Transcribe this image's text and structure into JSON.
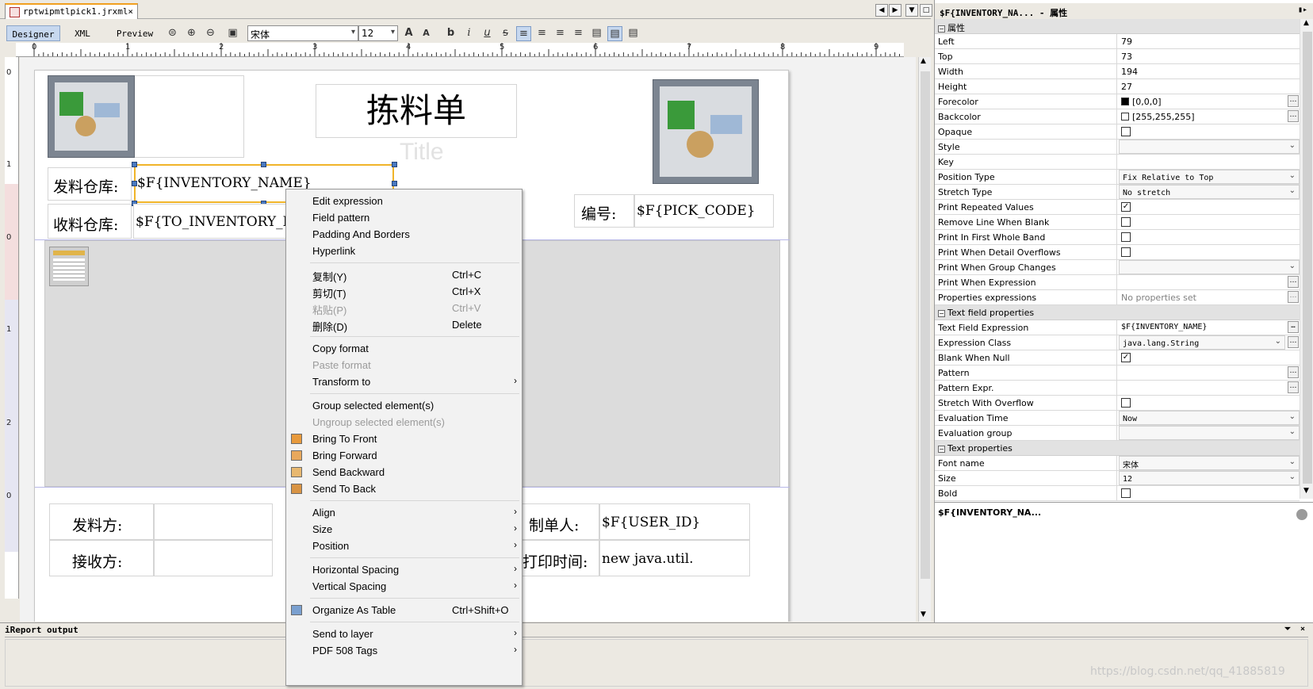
{
  "editor": {
    "file_tab": "rptwipmtlpick1.jrxml",
    "close_glyph": "×",
    "mode_tabs": [
      "Designer",
      "XML",
      "Preview"
    ],
    "font_name": "宋体",
    "font_size": "12",
    "ruler_h": [
      "0",
      "1",
      "2",
      "3",
      "4",
      "5",
      "6",
      "7",
      "8",
      "9"
    ],
    "ruler_v": [
      "0",
      "1",
      "0",
      "1",
      "2",
      "0"
    ]
  },
  "report": {
    "title": "拣料单",
    "title_placeholder": "Title",
    "issue_warehouse_label": "发料仓库:",
    "issue_warehouse_field": "$F{INVENTORY_NAME}",
    "receive_warehouse_label": "收料仓库:",
    "receive_warehouse_field": "$F{TO_INVENTORY_NAM",
    "code_label": "编号:",
    "code_field": "$F{PICK_CODE}",
    "issuer_label": "发料方:",
    "receiver_label": "接收方:",
    "creator_label": "制单人:",
    "creator_field": "$F{USER_ID}",
    "print_time_label": "打印时间:",
    "print_time_field": "new java.util."
  },
  "context_menu": {
    "items": [
      {
        "label": "Edit expression",
        "shortcut": "",
        "submenu": false,
        "disabled": false
      },
      {
        "label": "Field pattern",
        "shortcut": "",
        "submenu": false,
        "disabled": false
      },
      {
        "label": "Padding And Borders",
        "shortcut": "",
        "submenu": false,
        "disabled": false
      },
      {
        "label": "Hyperlink",
        "shortcut": "",
        "submenu": false,
        "disabled": false
      },
      {
        "label": "复制(Y)",
        "shortcut": "Ctrl+C",
        "submenu": false,
        "disabled": false
      },
      {
        "label": "剪切(T)",
        "shortcut": "Ctrl+X",
        "submenu": false,
        "disabled": false
      },
      {
        "label": "粘贴(P)",
        "shortcut": "Ctrl+V",
        "submenu": false,
        "disabled": true
      },
      {
        "label": "删除(D)",
        "shortcut": "Delete",
        "submenu": false,
        "disabled": false
      },
      {
        "label": "Copy format",
        "shortcut": "",
        "submenu": false,
        "disabled": false
      },
      {
        "label": "Paste format",
        "shortcut": "",
        "submenu": false,
        "disabled": true
      },
      {
        "label": "Transform to",
        "shortcut": "",
        "submenu": true,
        "disabled": false
      },
      {
        "label": "Group selected element(s)",
        "shortcut": "",
        "submenu": false,
        "disabled": false
      },
      {
        "label": "Ungroup selected element(s)",
        "shortcut": "",
        "submenu": false,
        "disabled": true
      },
      {
        "label": "Bring To Front",
        "shortcut": "",
        "submenu": false,
        "disabled": false,
        "icon": "bring-to-front-icon"
      },
      {
        "label": "Bring Forward",
        "shortcut": "",
        "submenu": false,
        "disabled": false,
        "icon": "bring-forward-icon"
      },
      {
        "label": "Send Backward",
        "shortcut": "",
        "submenu": false,
        "disabled": false,
        "icon": "send-backward-icon"
      },
      {
        "label": "Send To Back",
        "shortcut": "",
        "submenu": false,
        "disabled": false,
        "icon": "send-to-back-icon"
      },
      {
        "label": "Align",
        "shortcut": "",
        "submenu": true,
        "disabled": false
      },
      {
        "label": "Size",
        "shortcut": "",
        "submenu": true,
        "disabled": false
      },
      {
        "label": "Position",
        "shortcut": "",
        "submenu": true,
        "disabled": false
      },
      {
        "label": "Horizontal Spacing",
        "shortcut": "",
        "submenu": true,
        "disabled": false
      },
      {
        "label": "Vertical Spacing",
        "shortcut": "",
        "submenu": true,
        "disabled": false
      },
      {
        "label": "Organize As Table",
        "shortcut": "Ctrl+Shift+O",
        "submenu": false,
        "disabled": false,
        "icon": "table-icon"
      },
      {
        "label": "Send to layer",
        "shortcut": "",
        "submenu": true,
        "disabled": false
      },
      {
        "label": "PDF 508 Tags",
        "shortcut": "",
        "submenu": true,
        "disabled": false
      }
    ],
    "submenu_glyph": "›"
  },
  "properties": {
    "panel_title": "$F{INVENTORY_NA... - 属性",
    "categories": {
      "general": "属性",
      "text_field": "Text field properties",
      "text": "Text properties"
    },
    "rows": [
      {
        "name": "Left",
        "value": "79",
        "kind": "text"
      },
      {
        "name": "Top",
        "value": "73",
        "kind": "text"
      },
      {
        "name": "Width",
        "value": "194",
        "kind": "text"
      },
      {
        "name": "Height",
        "value": "27",
        "kind": "text"
      },
      {
        "name": "Forecolor",
        "value": "[0,0,0]",
        "kind": "color",
        "color": "#000000"
      },
      {
        "name": "Backcolor",
        "value": "[255,255,255]",
        "kind": "color",
        "color": "#ffffff"
      },
      {
        "name": "Opaque",
        "value": "",
        "kind": "check",
        "checked": false
      },
      {
        "name": "Style",
        "value": "",
        "kind": "dropdown"
      },
      {
        "name": "Key",
        "value": "",
        "kind": "text"
      },
      {
        "name": "Position Type",
        "value": "Fix Relative to Top",
        "kind": "dropdown"
      },
      {
        "name": "Stretch Type",
        "value": "No stretch",
        "kind": "dropdown"
      },
      {
        "name": "Print Repeated Values",
        "value": "",
        "kind": "check",
        "checked": true
      },
      {
        "name": "Remove Line When Blank",
        "value": "",
        "kind": "check",
        "checked": false
      },
      {
        "name": "Print In First Whole Band",
        "value": "",
        "kind": "check",
        "checked": false
      },
      {
        "name": "Print When Detail Overflows",
        "value": "",
        "kind": "check",
        "checked": false
      },
      {
        "name": "Print When Group Changes",
        "value": "",
        "kind": "dropdown"
      },
      {
        "name": "Print When Expression",
        "value": "",
        "kind": "ellipsis"
      },
      {
        "name": "Properties expressions",
        "value": "No properties set",
        "kind": "ellipsis-gray"
      },
      {
        "category": "text_field"
      },
      {
        "name": "Text Field Expression",
        "value": "$F{INVENTORY_NAME}",
        "kind": "ellipsis-mono"
      },
      {
        "name": "Expression Class",
        "value": "java.lang.String",
        "kind": "dropdown-ellipsis"
      },
      {
        "name": "Blank When Null",
        "value": "",
        "kind": "check",
        "checked": true
      },
      {
        "name": "Pattern",
        "value": "",
        "kind": "ellipsis"
      },
      {
        "name": "Pattern Expr.",
        "value": "",
        "kind": "ellipsis"
      },
      {
        "name": "Stretch With Overflow",
        "value": "",
        "kind": "check",
        "checked": false
      },
      {
        "name": "Evaluation Time",
        "value": "Now",
        "kind": "dropdown"
      },
      {
        "name": "Evaluation group",
        "value": "",
        "kind": "dropdown"
      },
      {
        "category": "text"
      },
      {
        "name": "Font name",
        "value": "宋体",
        "kind": "dropdown"
      },
      {
        "name": "Size",
        "value": "12",
        "kind": "dropdown"
      },
      {
        "name": "Bold",
        "value": "",
        "kind": "check",
        "checked": false
      }
    ],
    "description_title": "$F{INVENTORY_NA..."
  },
  "output": {
    "title": "iReport output"
  },
  "watermark": "https://blog.csdn.net/qq_41885819"
}
